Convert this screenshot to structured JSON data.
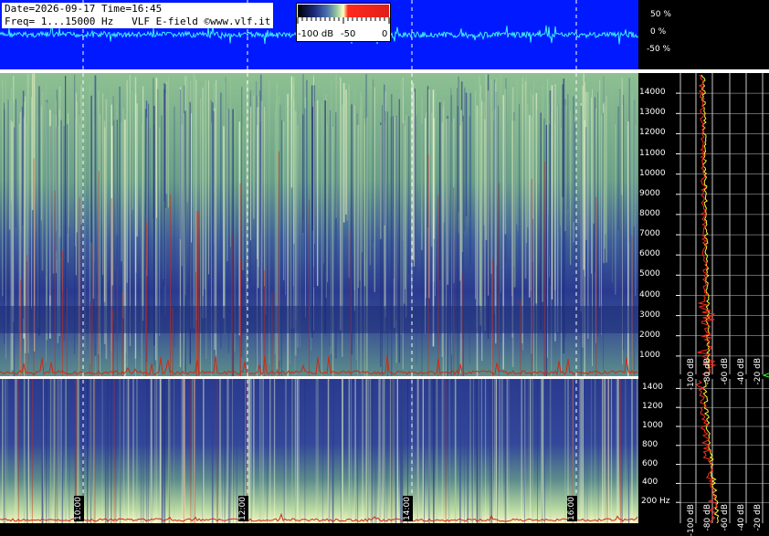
{
  "header": {
    "line1": "Date=2026-09-17 Time=16:45",
    "line2": "Freq= 1...15000 Hz   VLF E-field ©www.vlf.it"
  },
  "color_scale": {
    "labels": [
      "-100 dB",
      "-50",
      "0"
    ]
  },
  "colors": {
    "waveform_bg": "#0019ff",
    "waveform_trace": "#3ef0ff",
    "spectrum_line_1": "#ffff33",
    "spectrum_line_2": "#ff2a1a",
    "spec_low": "#2a3a8f",
    "spec_mid": "#7fb07a",
    "spec_high": "#ffffb0",
    "spec_peak": "#d12a10"
  },
  "chart_data": [
    {
      "type": "line",
      "title": "",
      "ylabel": "",
      "y_ticks": [
        "50 %",
        "0 %",
        "-50 %"
      ]
    },
    {
      "type": "heatmap",
      "title": "",
      "freq_range_hz": [
        1,
        15000
      ],
      "y_ticks": [
        "1000",
        "2000",
        "3000",
        "4000",
        "5000",
        "6000",
        "7000",
        "8000",
        "9000",
        "10000",
        "11000",
        "12000",
        "13000",
        "14000"
      ]
    },
    {
      "type": "heatmap",
      "title": "",
      "freq_range_hz": [
        1,
        1500
      ],
      "y_ticks": [
        "200 Hz",
        "400",
        "600",
        "800",
        "1000",
        "1200",
        "1400"
      ],
      "x_ticks": [
        "10:00",
        "12:00",
        "14:00",
        "16:00"
      ]
    },
    {
      "type": "line",
      "title": "",
      "x_ticks": [
        "-100 dB",
        "-80 dB",
        "-60 dB",
        "-40 dB",
        "-20 dB"
      ]
    }
  ]
}
